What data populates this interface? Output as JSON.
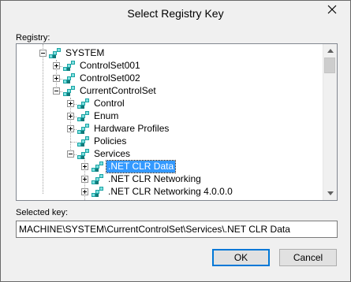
{
  "window": {
    "title": "Select Registry Key"
  },
  "tree": {
    "label": "Registry:",
    "nodes": [
      {
        "label": "SYSTEM"
      },
      {
        "label": "ControlSet001"
      },
      {
        "label": "ControlSet002"
      },
      {
        "label": "CurrentControlSet"
      },
      {
        "label": "Control"
      },
      {
        "label": "Enum"
      },
      {
        "label": "Hardware Profiles"
      },
      {
        "label": "Policies"
      },
      {
        "label": "Services"
      },
      {
        "label": ".NET CLR Data"
      },
      {
        "label": ".NET CLR Networking"
      },
      {
        "label": ".NET CLR Networking 4.0.0.0"
      }
    ],
    "selected_index": 9
  },
  "selected_key": {
    "label": "Selected key:",
    "value": "MACHINE\\SYSTEM\\CurrentControlSet\\Services\\.NET CLR Data"
  },
  "buttons": {
    "ok": "OK",
    "cancel": "Cancel"
  },
  "colors": {
    "selection": "#3399ff",
    "key_icon": "#1aa3a3",
    "default_button_border": "#0078d7"
  },
  "icons": {
    "close": "close-icon",
    "key": "registry-key-icon",
    "scroll_up": "scroll-up-arrow-icon",
    "scroll_down": "scroll-down-arrow-icon"
  }
}
